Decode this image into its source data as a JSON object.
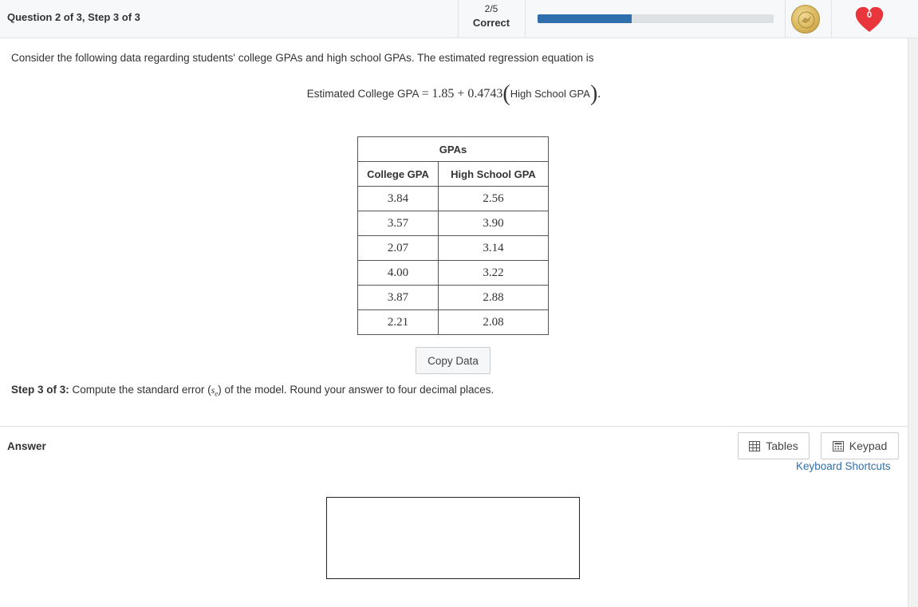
{
  "header": {
    "question_label": "Question 2 of 3, Step 3 of 3",
    "progress_fraction": "2/5",
    "status": "Correct",
    "progress_percent": 40,
    "coin_icon": "coin-icon",
    "heart_icon": "heart-icon",
    "hearts_count": "0"
  },
  "problem": {
    "intro": "Consider the following data regarding students' college GPAs and high school GPAs. The estimated regression equation is",
    "equation": {
      "lhs": "Estimated College GPA",
      "equals": "=",
      "rhs_math": "1.85 + 0.4743",
      "variable": "High School GPA",
      "end": "."
    },
    "table": {
      "title": "GPAs",
      "headers": [
        "College GPA",
        "High School GPA"
      ],
      "rows": [
        [
          "3.84",
          "2.56"
        ],
        [
          "3.57",
          "3.90"
        ],
        [
          "2.07",
          "3.14"
        ],
        [
          "4.00",
          "3.22"
        ],
        [
          "3.87",
          "2.88"
        ],
        [
          "2.21",
          "2.08"
        ]
      ]
    },
    "copy_button": "Copy Data",
    "step": {
      "label": "Step 3 of 3",
      "colon": ":",
      "text_before": "Compute the standard error (",
      "symbol": "s",
      "subscript": "e",
      "text_after": ") of the model. Round your answer to four decimal places."
    }
  },
  "answer": {
    "label": "Answer",
    "tables_button": "Tables",
    "keypad_button": "Keypad",
    "shortcuts_link": "Keyboard Shortcuts",
    "value": ""
  },
  "colors": {
    "accent": "#2f6fad",
    "heart": "#e8363c",
    "coin": "#d8b45a"
  }
}
